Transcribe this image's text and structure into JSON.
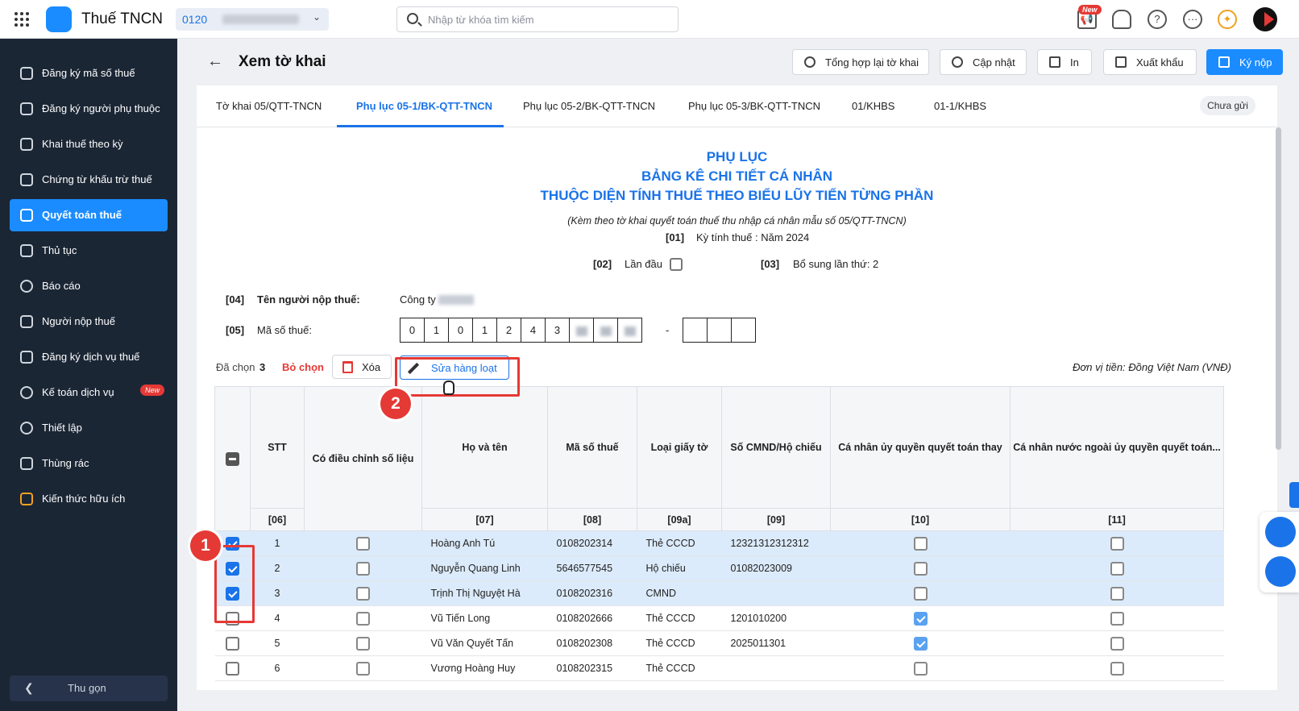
{
  "header": {
    "app_title": "Thuế TNCN",
    "org_code": "0120",
    "search_placeholder": "Nhập từ khóa tìm kiếm",
    "new_badge": "New"
  },
  "sidebar": {
    "items": [
      {
        "label": "Đăng ký mã số thuế",
        "icon": "scan-id-icon"
      },
      {
        "label": "Đăng ký người phụ thuộc",
        "icon": "people-icon"
      },
      {
        "label": "Khai thuế theo kỳ",
        "icon": "document-icon"
      },
      {
        "label": "Chứng từ khấu trừ thuế",
        "icon": "receipt-icon"
      },
      {
        "label": "Quyết toán thuế",
        "icon": "settlement-icon",
        "active": true
      },
      {
        "label": "Thủ tục",
        "icon": "folder-icon"
      },
      {
        "label": "Báo cáo",
        "icon": "pie-chart-icon"
      },
      {
        "label": "Người nộp thuế",
        "icon": "user-card-icon"
      },
      {
        "label": "Đăng ký dịch vụ thuế",
        "icon": "register-icon"
      },
      {
        "label": "Kế toán dịch vụ",
        "icon": "accounting-icon",
        "badge": "New"
      },
      {
        "label": "Thiết lập",
        "icon": "gear-icon"
      },
      {
        "label": "Thùng rác",
        "icon": "trash-icon"
      },
      {
        "label": "Kiến thức hữu ích",
        "icon": "bulb-icon"
      }
    ],
    "collapse_label": "Thu gọn"
  },
  "page": {
    "title": "Xem tờ khai",
    "buttons": {
      "recompile": "Tổng hợp lại tờ khai",
      "update": "Cập nhật",
      "print": "In",
      "export": "Xuất khẩu",
      "sign_submit": "Ký nộp"
    }
  },
  "tabs": [
    "Tờ khai 05/QTT-TNCN",
    "Phụ lục 05-1/BK-QTT-TNCN",
    "Phụ lục 05-2/BK-QTT-TNCN",
    "Phụ lục 05-3/BK-QTT-TNCN",
    "01/KHBS",
    "01-1/KHBS"
  ],
  "status_chip": "Chưa gửi",
  "form": {
    "title1": "PHỤ LỤC",
    "title2": "BẢNG KÊ CHI TIẾT CÁ NHÂN",
    "title3": "THUỘC DIỆN TÍNH THUẾ THEO BIỂU LŨY TIẾN TỪNG PHẦN",
    "subtitle": "(Kèm theo tờ khai quyết toán thuế thu nhập cá nhân mẫu số 05/QTT-TNCN)",
    "code01": "[01]",
    "period": "Kỳ tính thuế : Năm 2024",
    "code02": "[02]",
    "first_time": "Lần đầu",
    "code03": "[03]",
    "supplement": "Bổ sung lần thứ: 2",
    "code04": "[04]",
    "taxpayer_label": "Tên người nộp thuế:",
    "taxpayer_value": "Công ty",
    "code05": "[05]",
    "taxcode_label": "Mã số thuế:",
    "taxcode_digits": [
      "0",
      "1",
      "0",
      "1",
      "2",
      "4",
      "3"
    ],
    "dash": "-"
  },
  "toolbar": {
    "selected_label": "Đã chọn",
    "selected_count": "3",
    "deselect": "Bỏ chọn",
    "delete": "Xóa",
    "bulk_edit": "Sửa hàng loạt",
    "currency_unit": "Đơn vị tiền: Đồng Việt Nam (VNĐ)"
  },
  "callouts": {
    "one": "1",
    "two": "2"
  },
  "table": {
    "headers": [
      "STT",
      "Có điều chỉnh số liệu",
      "Họ và tên",
      "Mã số thuế",
      "Loại giấy tờ",
      "Số CMND/Hộ chiếu",
      "Cá nhân ủy quyền quyết toán thay",
      "Cá nhân nước ngoài ủy quyền quyết toán..."
    ],
    "codes": [
      "[06]",
      "[07]",
      "[08]",
      "[09a]",
      "[09]",
      "[10]",
      "[11]"
    ],
    "rows": [
      {
        "stt": "1",
        "name": "Hoàng Anh Tú",
        "mst": "0108202314",
        "doc": "Thẻ CCCD",
        "id": "12321312312312"
      },
      {
        "stt": "2",
        "name": "Nguyễn Quang Linh",
        "mst": "5646577545",
        "doc": "Hộ chiếu",
        "id": "01082023009"
      },
      {
        "stt": "3",
        "name": "Trịnh Thị Nguyệt Hà",
        "mst": "0108202316",
        "doc": "CMND",
        "id": ""
      },
      {
        "stt": "4",
        "name": "Vũ Tiến Long",
        "mst": "0108202666",
        "doc": "Thẻ CCCD",
        "id": "1201010200"
      },
      {
        "stt": "5",
        "name": "Vũ Văn Quyết Tấn",
        "mst": "0108202308",
        "doc": "Thẻ CCCD",
        "id": "2025011301"
      },
      {
        "stt": "6",
        "name": "Vương Hoàng Huy",
        "mst": "0108202315",
        "doc": "Thẻ CCCD",
        "id": ""
      }
    ]
  },
  "colors": {
    "accent": "#1a8cff",
    "sidebar": "#1b2635",
    "danger": "#e53935",
    "selected_row": "#dcebfb"
  }
}
